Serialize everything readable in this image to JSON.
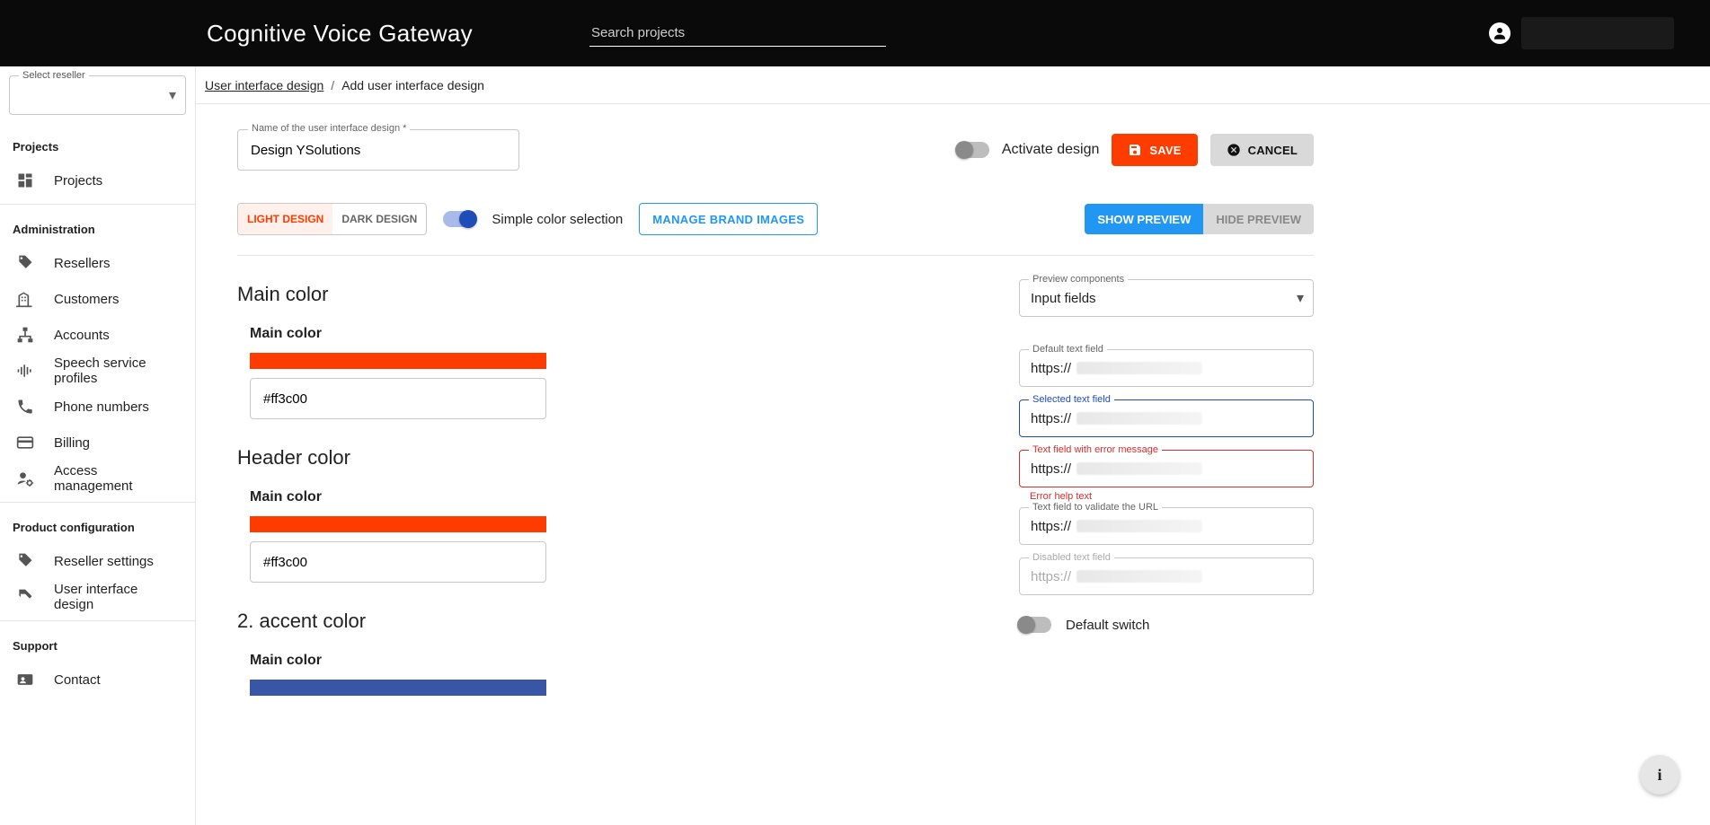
{
  "header": {
    "brand": "Cognitive Voice Gateway",
    "search_placeholder": "Search projects"
  },
  "sidebar": {
    "reseller_label": "Select reseller",
    "sections": {
      "projects_title": "Projects",
      "administration_title": "Administration",
      "product_config_title": "Product configuration",
      "support_title": "Support"
    },
    "items": {
      "projects": "Projects",
      "resellers": "Resellers",
      "customers": "Customers",
      "accounts": "Accounts",
      "speech": "Speech service profiles",
      "phone": "Phone numbers",
      "billing": "Billing",
      "access": "Access management",
      "reseller_settings": "Reseller settings",
      "ui_design": "User interface design",
      "contact": "Contact"
    }
  },
  "breadcrumb": {
    "root": "User interface design",
    "current": "Add user interface design"
  },
  "form": {
    "name_label": "Name of the user interface design *",
    "name_value": "Design YSolutions",
    "activate_label": "Activate design",
    "save_label": "SAVE",
    "cancel_label": "CANCEL",
    "light_tab": "LIGHT DESIGN",
    "dark_tab": "DARK DESIGN",
    "simple_color_label": "Simple color selection",
    "manage_brand_label": "MANAGE BRAND IMAGES",
    "show_preview": "SHOW PREVIEW",
    "hide_preview": "HIDE PREVIEW"
  },
  "colors": {
    "section_main": "Main color",
    "section_header": "Header color",
    "section_accent": "2. accent color",
    "sub_main": "Main color",
    "main_value": "#ff3c00",
    "main_swatch": "#ff3c00",
    "header_value": "#ff3c00",
    "header_swatch": "#ff3c00",
    "accent_swatch": "#3956a6"
  },
  "preview": {
    "components_label": "Preview components",
    "components_value": "Input fields",
    "default_label": "Default text field",
    "default_value": "https://",
    "selected_label": "Selected text field",
    "selected_value": "https://",
    "error_label": "Text field with error message",
    "error_value": "https://",
    "error_help": "Error help text",
    "url_label": "Text field to validate the URL",
    "url_value": "https://",
    "disabled_label": "Disabled text field",
    "disabled_value": "https://",
    "default_switch_label": "Default switch"
  },
  "fab_info": "i"
}
